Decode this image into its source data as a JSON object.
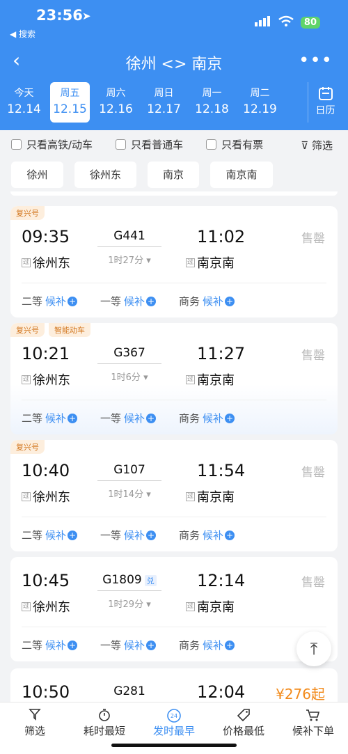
{
  "status": {
    "time": "23:56",
    "back_app": "◀ 搜索",
    "battery": "80"
  },
  "nav": {
    "title": "徐州 <> 南京",
    "back": "‹",
    "more": "•••"
  },
  "dates": [
    {
      "weekday": "今天",
      "date": "12.14"
    },
    {
      "weekday": "周五",
      "date": "12.15"
    },
    {
      "weekday": "周六",
      "date": "12.16"
    },
    {
      "weekday": "周日",
      "date": "12.17"
    },
    {
      "weekday": "周一",
      "date": "12.18"
    },
    {
      "weekday": "周二",
      "date": "12.19"
    }
  ],
  "calendar_label": "日历",
  "filters": {
    "high_speed": "只看高铁/动车",
    "normal": "只看普通车",
    "available": "只看有票",
    "filter": "筛选"
  },
  "stations": [
    "徐州",
    "徐州东",
    "南京",
    "南京南"
  ],
  "via": "过",
  "seat_labels": {
    "second": "二等",
    "first": "一等",
    "business": "商务",
    "waitlist": "候补"
  },
  "trains": [
    {
      "tags": [
        "复兴号"
      ],
      "dep_time": "09:35",
      "train_no": "G441",
      "arr_time": "11:02",
      "duration": "1时27分",
      "dep_station": "徐州东",
      "arr_station": "南京南",
      "status": "售罄"
    },
    {
      "tags": [
        "复兴号",
        "智能动车"
      ],
      "dep_time": "10:21",
      "train_no": "G367",
      "arr_time": "11:27",
      "duration": "1时6分",
      "dep_station": "徐州东",
      "arr_station": "南京南",
      "status": "售罄"
    },
    {
      "tags": [
        "复兴号"
      ],
      "dep_time": "10:40",
      "train_no": "G107",
      "arr_time": "11:54",
      "duration": "1时14分",
      "dep_station": "徐州东",
      "arr_station": "南京南",
      "status": "售罄"
    },
    {
      "tags": [],
      "dep_time": "10:45",
      "train_no": "G1809",
      "badge": "兑",
      "arr_time": "12:14",
      "duration": "1时29分",
      "dep_station": "徐州东",
      "arr_station": "南京南",
      "status": "售罄"
    },
    {
      "tags": [],
      "dep_time": "10:50",
      "train_no": "G281",
      "arr_time": "12:04",
      "price": "¥276起"
    }
  ],
  "tabbar": [
    {
      "label": "筛选",
      "icon": "filter-icon"
    },
    {
      "label": "耗时最短",
      "icon": "timer-icon"
    },
    {
      "label": "发时最早",
      "icon": "clock-24-icon"
    },
    {
      "label": "价格最低",
      "icon": "price-tag-icon"
    },
    {
      "label": "候补下单",
      "icon": "cart-icon"
    }
  ],
  "colors": {
    "primary": "#3d8ff2",
    "orange": "#f28a1a",
    "sold": "#bbbbbb"
  }
}
